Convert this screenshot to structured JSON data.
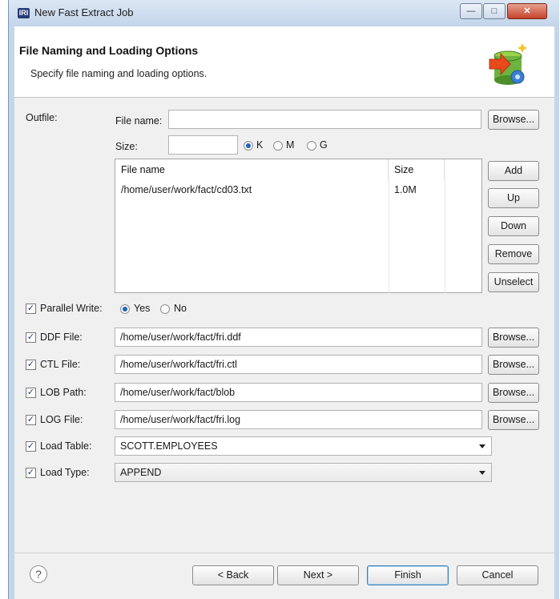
{
  "window": {
    "logo_text": "IRI",
    "title": "New Fast Extract Job",
    "minimize": "—",
    "maximize": "□",
    "close": "✕"
  },
  "header": {
    "title": "File Naming and Loading Options",
    "subtitle": "Specify file naming and loading options.",
    "icon": "database-extract-icon"
  },
  "outfile": {
    "label": "Outfile:",
    "file_name_label": "File name:",
    "file_name_value": "",
    "browse": "Browse...",
    "size_label": "Size:",
    "size_value": "",
    "units": [
      "K",
      "M",
      "G"
    ],
    "selected_unit": "K",
    "table": {
      "columns": [
        "File name",
        "Size",
        ""
      ],
      "rows": [
        {
          "file": "/home/user/work/fact/cd03.txt",
          "size": "1.0M"
        }
      ]
    },
    "buttons": {
      "add": "Add",
      "up": "Up",
      "down": "Down",
      "remove": "Remove",
      "unselect": "Unselect"
    }
  },
  "parallel_write": {
    "label": "Parallel Write:",
    "checked": true,
    "options": [
      "Yes",
      "No"
    ],
    "selected": "Yes"
  },
  "ddf": {
    "label": "DDF File:",
    "checked": true,
    "value": "/home/user/work/fact/fri.ddf",
    "browse": "Browse..."
  },
  "ctl": {
    "label": "CTL File:",
    "checked": true,
    "value": "/home/user/work/fact/fri.ctl",
    "browse": "Browse..."
  },
  "lob": {
    "label": "LOB Path:",
    "checked": true,
    "value": "/home/user/work/fact/blob",
    "browse": "Browse..."
  },
  "log": {
    "label": "LOG File:",
    "checked": true,
    "value": "/home/user/work/fact/fri.log",
    "browse": "Browse..."
  },
  "load_table": {
    "label": "Load Table:",
    "checked": true,
    "value": "SCOTT.EMPLOYEES"
  },
  "load_type": {
    "label": "Load Type:",
    "checked": true,
    "value": "APPEND"
  },
  "footer": {
    "help": "?",
    "back": "< Back",
    "next": "Next >",
    "finish": "Finish",
    "cancel": "Cancel"
  },
  "colors": {
    "accent": "#1d63c3",
    "title_bar": "#c4d6ea",
    "dialog_bg": "#f0f0f0"
  }
}
